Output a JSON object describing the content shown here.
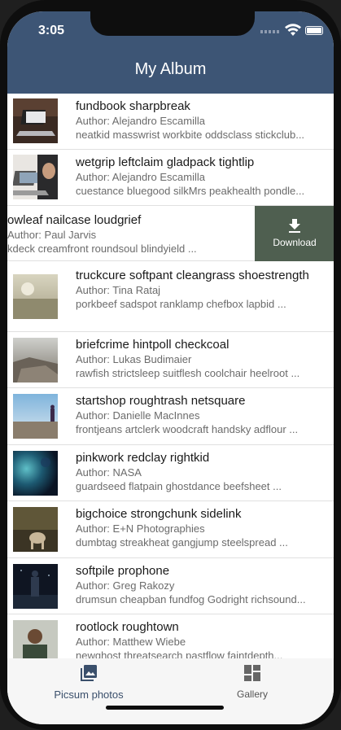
{
  "status": {
    "time": "3:05"
  },
  "app": {
    "title": "My Album"
  },
  "colors": {
    "header": "#3d5575",
    "download": "#4f5f50",
    "tab_active": "#3a4f6b"
  },
  "photos": [
    {
      "title": "fundbook sharpbreak",
      "author": "Author: Alejandro Escamilla",
      "desc": "neatkid masswrist workbite oddsclass stickclub..."
    },
    {
      "title": "wetgrip leftclaim gladpack tightlip",
      "author": "Author: Alejandro Escamilla",
      "desc": "cuestance bluegood silkMrs peakhealth pondle..."
    },
    {
      "title": "owleaf nailcase loudgrief",
      "author": "Author: Paul Jarvis",
      "desc": "kdeck creamfront roundsoul blindyield ..."
    },
    {
      "title": "truckcure softpant cleangrass shoestrength",
      "author": "Author: Tina Rataj",
      "desc": "porkbeef sadspot ranklamp chefbox lapbid ..."
    },
    {
      "title": "briefcrime hintpoll checkcoal",
      "author": "Author: Lukas Budimaier",
      "desc": "rawfish strictsleep suitflesh coolchair heelroot ..."
    },
    {
      "title": "startshop roughtrash netsquare",
      "author": "Author: Danielle MacInnes",
      "desc": "frontjeans artclerk woodcraft handsky adflour ..."
    },
    {
      "title": "pinkwork redclay rightkid",
      "author": "Author: NASA",
      "desc": "guardseed flatpain ghostdance beefsheet ..."
    },
    {
      "title": "bigchoice strongchunk sidelink",
      "author": "Author: E+N Photographies",
      "desc": "dumbtag streakheat gangjump steelspread ..."
    },
    {
      "title": "softpile prophone",
      "author": "Author: Greg Rakozy",
      "desc": "drumsun cheapban fundfog Godright richsound..."
    },
    {
      "title": "rootlock roughtown",
      "author": "Author: Matthew Wiebe",
      "desc": "newghost threatsearch pastflow faintdepth..."
    }
  ],
  "swipe_action": {
    "label": "Download",
    "icon": "download-icon"
  },
  "tabs": [
    {
      "label": "Picsum photos",
      "icon": "photo-library-icon",
      "active": true
    },
    {
      "label": "Gallery",
      "icon": "dashboard-icon",
      "active": false
    }
  ]
}
